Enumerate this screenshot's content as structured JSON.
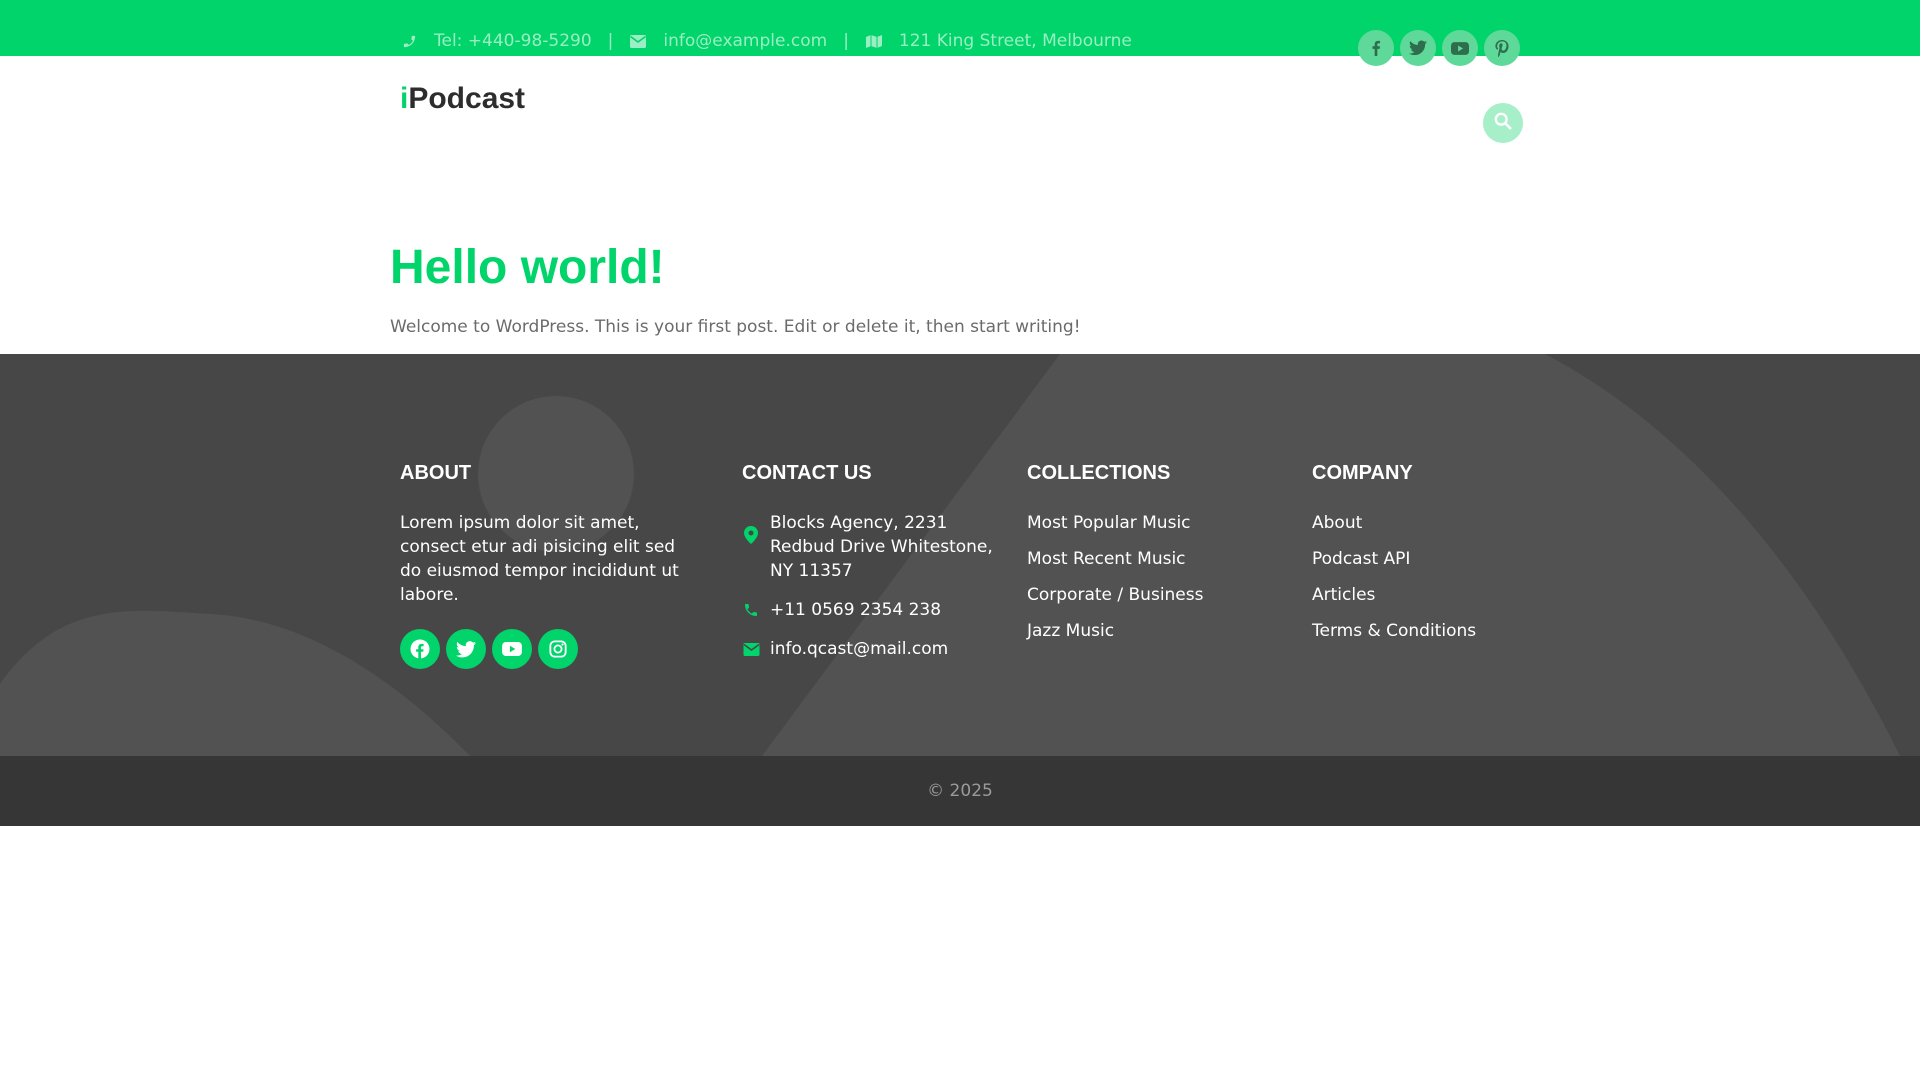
{
  "colors": {
    "accent": "#00d46a",
    "footer_bg": "#474747",
    "copyright_bg": "#363636"
  },
  "topbar": {
    "phone": "Tel: +440-98-5290",
    "email": "info@example.com",
    "address": "121 King Street, Melbourne",
    "separator": "|",
    "social_icons": [
      "facebook-icon",
      "twitter-icon",
      "youtube-icon",
      "pinterest-icon"
    ]
  },
  "header": {
    "logo_prefix": "i",
    "logo_name": "Podcast"
  },
  "post": {
    "title": "Hello world!",
    "excerpt": "Welcome to WordPress. This is your first post. Edit or delete it, then start writing!"
  },
  "footer": {
    "about": {
      "heading": "ABOUT",
      "text": "Lorem ipsum dolor sit amet, consect etur adi pisicing elit sed do eiusmod tempor incididunt ut labore.",
      "social_icons": [
        "facebook-icon",
        "twitter-icon",
        "youtube-icon",
        "instagram-icon"
      ]
    },
    "contact": {
      "heading": "CONTACT US",
      "address": "Blocks Agency, 2231 Redbud Drive Whitestone, NY 11357",
      "phone": "+11 0569 2354 238",
      "email": "info.qcast@mail.com"
    },
    "collections": {
      "heading": "COLLECTIONS",
      "items": [
        "Most Popular Music",
        "Most Recent Music",
        "Corporate / Business",
        "Jazz Music"
      ]
    },
    "company": {
      "heading": "COMPANY",
      "items": [
        "About",
        "Podcast API",
        "Articles",
        "Terms & Conditions"
      ]
    }
  },
  "copyright": "© 2025"
}
